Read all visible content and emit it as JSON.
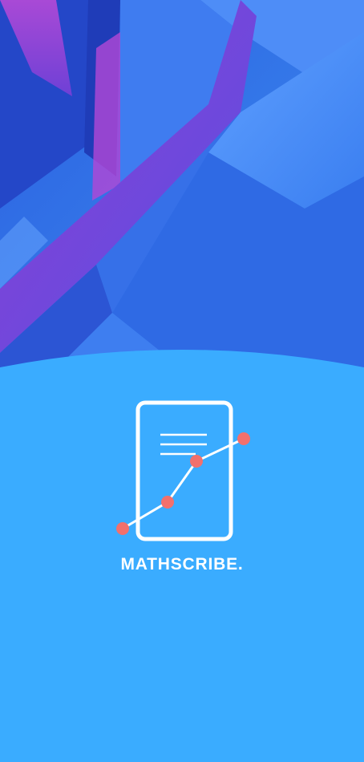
{
  "app": {
    "brand_name": "MATHSCRIBE."
  },
  "hero": {
    "image": "abstract-geometric-blue-purple-background"
  },
  "logo": {
    "icon": "document-chart-icon",
    "colors": {
      "outline": "#ffffff",
      "points": "#f2706d"
    }
  },
  "colors": {
    "background": "#3aacff",
    "accent": "#f2706d"
  }
}
